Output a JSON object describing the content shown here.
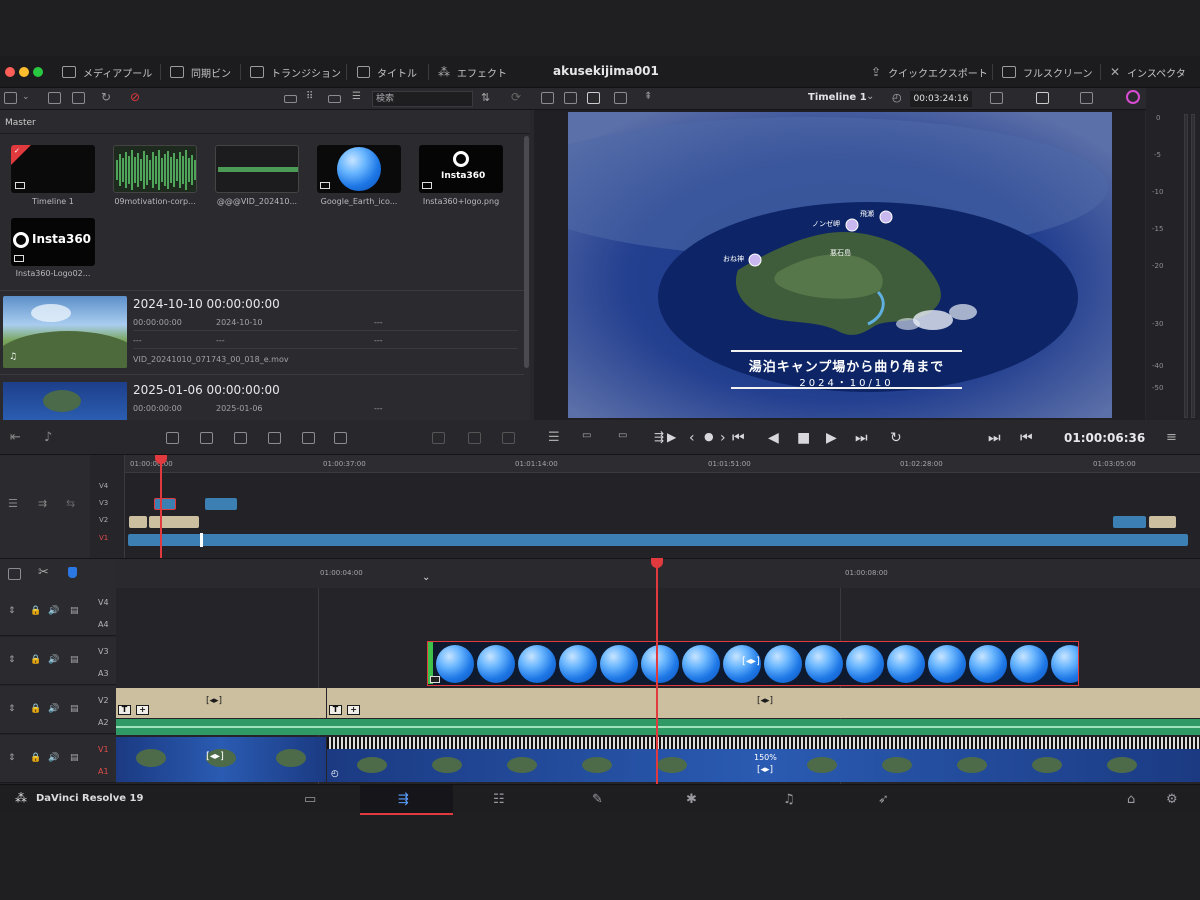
{
  "toolbar": {
    "media_pool": "メディアプール",
    "sync_bin": "同期ビン",
    "transitions": "トランジション",
    "titles": "タイトル",
    "effects": "エフェクト",
    "project_title": "akusekijima001",
    "quick_export": "クイックエクスポート",
    "fullscreen": "フルスクリーン",
    "inspector": "インスペクタ"
  },
  "media_bar": {
    "search_placeholder": "検索",
    "bin": "Master"
  },
  "thumbnails": [
    {
      "label": "Timeline 1"
    },
    {
      "label": "09motivation-corp..."
    },
    {
      "label": "@@@VID_202410..."
    },
    {
      "label": "Google_Earth_ico..."
    },
    {
      "label": "Insta360+logo.png"
    },
    {
      "label": "Insta360-Logo02..."
    }
  ],
  "logo_texts": {
    "insta_small": "Insta360",
    "insta_big": "Insta360"
  },
  "clips": [
    {
      "title": "2024-10-10  00:00:00:00",
      "meta1": "00:00:00:00",
      "meta2": "2024-10-10",
      "meta3": "---",
      "r2a": "---",
      "r2b": "---",
      "r2c": "---",
      "file": "VID_20241010_071743_00_018_e.mov"
    },
    {
      "title": "2025-01-06  00:00:00:00",
      "meta1": "00:00:00:00",
      "meta2": "2025-01-06",
      "meta3": "---"
    }
  ],
  "viewer": {
    "timeline_name": "Timeline 1",
    "duration": "00:03:24:16",
    "caption_line1": "湯泊キャンプ場から曲り角まで",
    "caption_line2": "2024・10/10",
    "poi": [
      {
        "label": "飛瀬"
      },
      {
        "label": "ノンゼ岬"
      },
      {
        "label": "おね神"
      },
      {
        "label": "悪石島"
      }
    ]
  },
  "meters": {
    "labels": [
      "0",
      "-5",
      "-10",
      "-15",
      "-20",
      "-30",
      "-40",
      "-50"
    ]
  },
  "transport": {
    "timecode": "01:00:06:36"
  },
  "mini_timeline": {
    "ruler": [
      "01:00:00:00",
      "01:00:37:00",
      "01:01:14:00",
      "01:01:51:00",
      "01:02:28:00",
      "01:03:05:00"
    ],
    "tracks": [
      "V4",
      "V3",
      "V2",
      "V1"
    ]
  },
  "main_timeline": {
    "ruler": [
      "01:00:04:00",
      "01:00:08:00"
    ],
    "tracks": [
      {
        "v": "V4",
        "a": "A4"
      },
      {
        "v": "V3",
        "a": "A3"
      },
      {
        "v": "V2",
        "a": "A2"
      },
      {
        "v": "V1",
        "a": "A1"
      }
    ],
    "speed": "150%",
    "link_glyph": "[◂▸]"
  },
  "footer": {
    "brand": "DaVinci Resolve 19"
  },
  "colors": {
    "accent_red": "#e0393e",
    "clip_blue": "#3b7fb3",
    "clip_tan": "#cbbf9f",
    "audio_green": "#2f9a66"
  }
}
